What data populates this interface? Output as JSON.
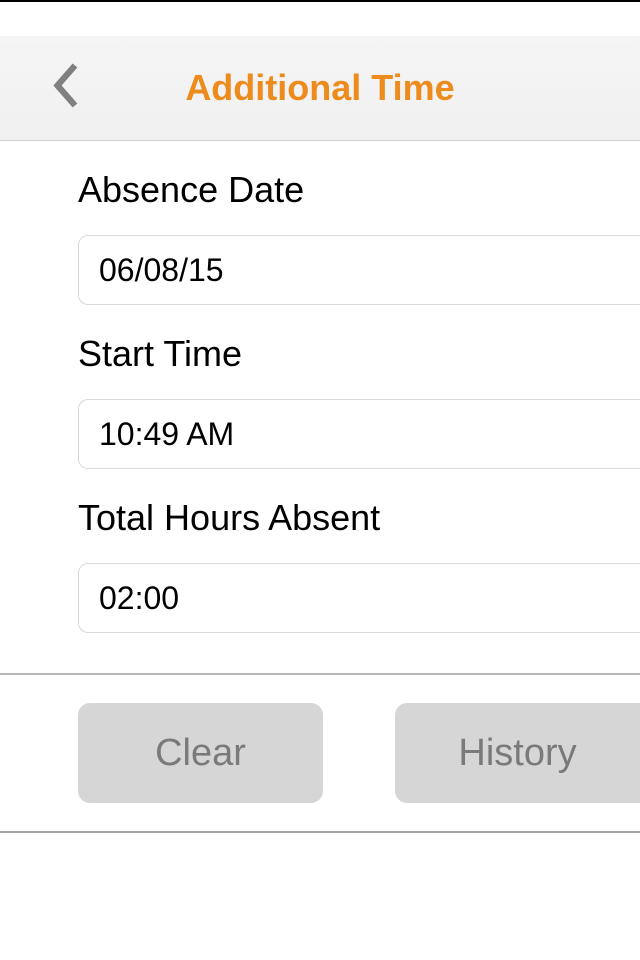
{
  "header": {
    "title": "Additional Time"
  },
  "form": {
    "absence_date": {
      "label": "Absence Date",
      "value": "06/08/15"
    },
    "start_time": {
      "label": "Start Time",
      "value": "10:49 AM"
    },
    "total_hours": {
      "label": "Total Hours Absent",
      "value": "02:00"
    }
  },
  "buttons": {
    "clear": "Clear",
    "history": "History"
  }
}
